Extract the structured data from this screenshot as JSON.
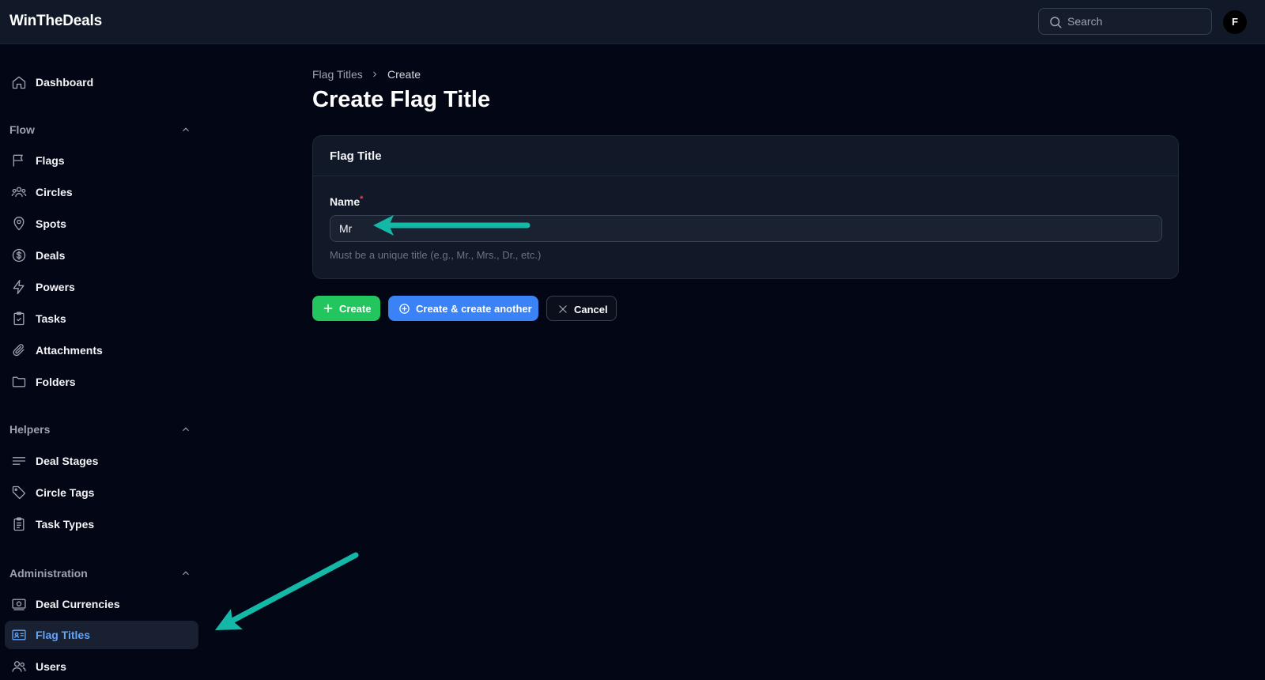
{
  "header": {
    "brand": "WinTheDeals",
    "search_placeholder": "Search",
    "avatar_initial": "F"
  },
  "sidebar": {
    "dashboard": "Dashboard",
    "groups": [
      {
        "label": "Flow",
        "items": [
          "Flags",
          "Circles",
          "Spots",
          "Deals",
          "Powers",
          "Tasks",
          "Attachments",
          "Folders"
        ]
      },
      {
        "label": "Helpers",
        "items": [
          "Deal Stages",
          "Circle Tags",
          "Task Types"
        ]
      },
      {
        "label": "Administration",
        "items": [
          "Deal Currencies",
          "Flag Titles",
          "Users"
        ]
      }
    ],
    "active_item": "Flag Titles"
  },
  "breadcrumb": {
    "parent": "Flag Titles",
    "current": "Create"
  },
  "page_title": "Create Flag Title",
  "form": {
    "section_title": "Flag Title",
    "name_label": "Name",
    "required_mark": "*",
    "name_value": "Mr",
    "helper_text": "Must be a unique title (e.g., Mr., Mrs., Dr., etc.)"
  },
  "actions": {
    "create": "Create",
    "create_another": "Create & create another",
    "cancel": "Cancel"
  },
  "colors": {
    "accent_blue": "#3b82f6",
    "create_green": "#22c55e",
    "active_text": "#60a5fa",
    "annotation_arrow": "#14b8a6"
  }
}
